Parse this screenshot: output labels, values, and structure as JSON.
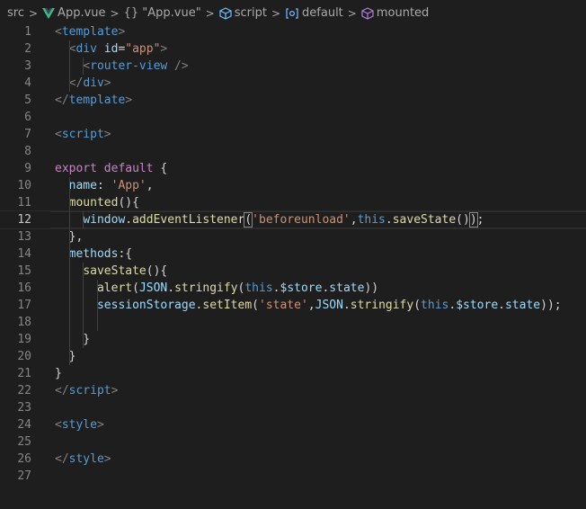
{
  "breadcrumb": {
    "items": [
      {
        "label": "src",
        "icon": "none"
      },
      {
        "label": "App.vue",
        "icon": "vue-logo-icon"
      },
      {
        "label": "{} \"App.vue\"",
        "icon": "none"
      },
      {
        "label": "script",
        "icon": "cube-icon"
      },
      {
        "label": "default",
        "icon": "module-icon"
      },
      {
        "label": "mounted",
        "icon": "method-cube-icon"
      }
    ],
    "separator": ">"
  },
  "editor": {
    "current_line": 12,
    "line_numbers": [
      "1",
      "2",
      "3",
      "4",
      "5",
      "6",
      "7",
      "8",
      "9",
      "10",
      "11",
      "12",
      "13",
      "14",
      "15",
      "16",
      "17",
      "18",
      "19",
      "20",
      "21",
      "22",
      "23",
      "24",
      "25",
      "26",
      "27"
    ],
    "lines": [
      [
        {
          "t": "<",
          "c": "br"
        },
        {
          "t": "template",
          "c": "tag"
        },
        {
          "t": ">",
          "c": "br"
        }
      ],
      [
        {
          "t": "  <",
          "c": "br"
        },
        {
          "t": "div",
          "c": "tag"
        },
        {
          "t": " ",
          "c": "plain"
        },
        {
          "t": "id",
          "c": "attr"
        },
        {
          "t": "=",
          "c": "plain"
        },
        {
          "t": "\"app\"",
          "c": "str"
        },
        {
          "t": ">",
          "c": "br"
        }
      ],
      [
        {
          "t": "    <",
          "c": "br"
        },
        {
          "t": "router-view",
          "c": "tag"
        },
        {
          "t": " />",
          "c": "br"
        }
      ],
      [
        {
          "t": "  </",
          "c": "br"
        },
        {
          "t": "div",
          "c": "tag"
        },
        {
          "t": ">",
          "c": "br"
        }
      ],
      [
        {
          "t": "</",
          "c": "br"
        },
        {
          "t": "template",
          "c": "tag"
        },
        {
          "t": ">",
          "c": "br"
        }
      ],
      [],
      [
        {
          "t": "<",
          "c": "br"
        },
        {
          "t": "script",
          "c": "tag"
        },
        {
          "t": ">",
          "c": "br"
        }
      ],
      [],
      [
        {
          "t": "export",
          "c": "kw"
        },
        {
          "t": " ",
          "c": "plain"
        },
        {
          "t": "default",
          "c": "kw"
        },
        {
          "t": " {",
          "c": "plain"
        }
      ],
      [
        {
          "t": "  ",
          "c": "plain"
        },
        {
          "t": "name",
          "c": "prop"
        },
        {
          "t": ": ",
          "c": "plain"
        },
        {
          "t": "'App'",
          "c": "str"
        },
        {
          "t": ",",
          "c": "plain"
        }
      ],
      [
        {
          "t": "  ",
          "c": "plain"
        },
        {
          "t": "mounted",
          "c": "fn"
        },
        {
          "t": "(){",
          "c": "plain"
        }
      ],
      [
        {
          "t": "    ",
          "c": "plain"
        },
        {
          "t": "window",
          "c": "var"
        },
        {
          "t": ".",
          "c": "plain"
        },
        {
          "t": "addEventListener",
          "c": "fn"
        },
        {
          "t": "(",
          "c": "match"
        },
        {
          "t": "'beforeunload'",
          "c": "str"
        },
        {
          "t": ",",
          "c": "plain"
        },
        {
          "t": "this",
          "c": "this"
        },
        {
          "t": ".",
          "c": "plain"
        },
        {
          "t": "saveState",
          "c": "fn"
        },
        {
          "t": "()",
          "c": "plain"
        },
        {
          "t": ")",
          "c": "match"
        },
        {
          "t": ";",
          "c": "plain"
        }
      ],
      [
        {
          "t": "  },",
          "c": "plain"
        }
      ],
      [
        {
          "t": "  ",
          "c": "plain"
        },
        {
          "t": "methods",
          "c": "prop"
        },
        {
          "t": ":{",
          "c": "plain"
        }
      ],
      [
        {
          "t": "    ",
          "c": "plain"
        },
        {
          "t": "saveState",
          "c": "fn"
        },
        {
          "t": "(){",
          "c": "plain"
        }
      ],
      [
        {
          "t": "      ",
          "c": "plain"
        },
        {
          "t": "alert",
          "c": "fn"
        },
        {
          "t": "(",
          "c": "plain"
        },
        {
          "t": "JSON",
          "c": "var"
        },
        {
          "t": ".",
          "c": "plain"
        },
        {
          "t": "stringify",
          "c": "fn"
        },
        {
          "t": "(",
          "c": "plain"
        },
        {
          "t": "this",
          "c": "this"
        },
        {
          "t": ".",
          "c": "plain"
        },
        {
          "t": "$store",
          "c": "var"
        },
        {
          "t": ".",
          "c": "plain"
        },
        {
          "t": "state",
          "c": "var"
        },
        {
          "t": "))",
          "c": "plain"
        }
      ],
      [
        {
          "t": "      ",
          "c": "plain"
        },
        {
          "t": "sessionStorage",
          "c": "var"
        },
        {
          "t": ".",
          "c": "plain"
        },
        {
          "t": "setItem",
          "c": "fn"
        },
        {
          "t": "(",
          "c": "plain"
        },
        {
          "t": "'state'",
          "c": "str"
        },
        {
          "t": ",",
          "c": "plain"
        },
        {
          "t": "JSON",
          "c": "var"
        },
        {
          "t": ".",
          "c": "plain"
        },
        {
          "t": "stringify",
          "c": "fn"
        },
        {
          "t": "(",
          "c": "plain"
        },
        {
          "t": "this",
          "c": "this"
        },
        {
          "t": ".",
          "c": "plain"
        },
        {
          "t": "$store",
          "c": "var"
        },
        {
          "t": ".",
          "c": "plain"
        },
        {
          "t": "state",
          "c": "var"
        },
        {
          "t": "));",
          "c": "plain"
        }
      ],
      [],
      [
        {
          "t": "    }",
          "c": "plain"
        }
      ],
      [
        {
          "t": "  }",
          "c": "plain"
        }
      ],
      [
        {
          "t": "}",
          "c": "plain"
        }
      ],
      [
        {
          "t": "</",
          "c": "br"
        },
        {
          "t": "script",
          "c": "tag"
        },
        {
          "t": ">",
          "c": "br"
        }
      ],
      [],
      [
        {
          "t": "<",
          "c": "br"
        },
        {
          "t": "style",
          "c": "tag"
        },
        {
          "t": ">",
          "c": "br"
        }
      ],
      [],
      [
        {
          "t": "</",
          "c": "br"
        },
        {
          "t": "style",
          "c": "tag"
        },
        {
          "t": ">",
          "c": "br"
        }
      ],
      []
    ]
  },
  "colors": {
    "background": "#1e1e1e",
    "line_number": "#858585",
    "line_number_active": "#c6c6c6",
    "tag": "#569cd6",
    "bracket": "#808080",
    "attribute": "#9cdcfe",
    "string": "#ce9178",
    "keyword": "#c586c0",
    "function": "#dcdcaa",
    "variable": "#9cdcfe",
    "text": "#d4d4d4",
    "vue_green": "#41b883"
  }
}
